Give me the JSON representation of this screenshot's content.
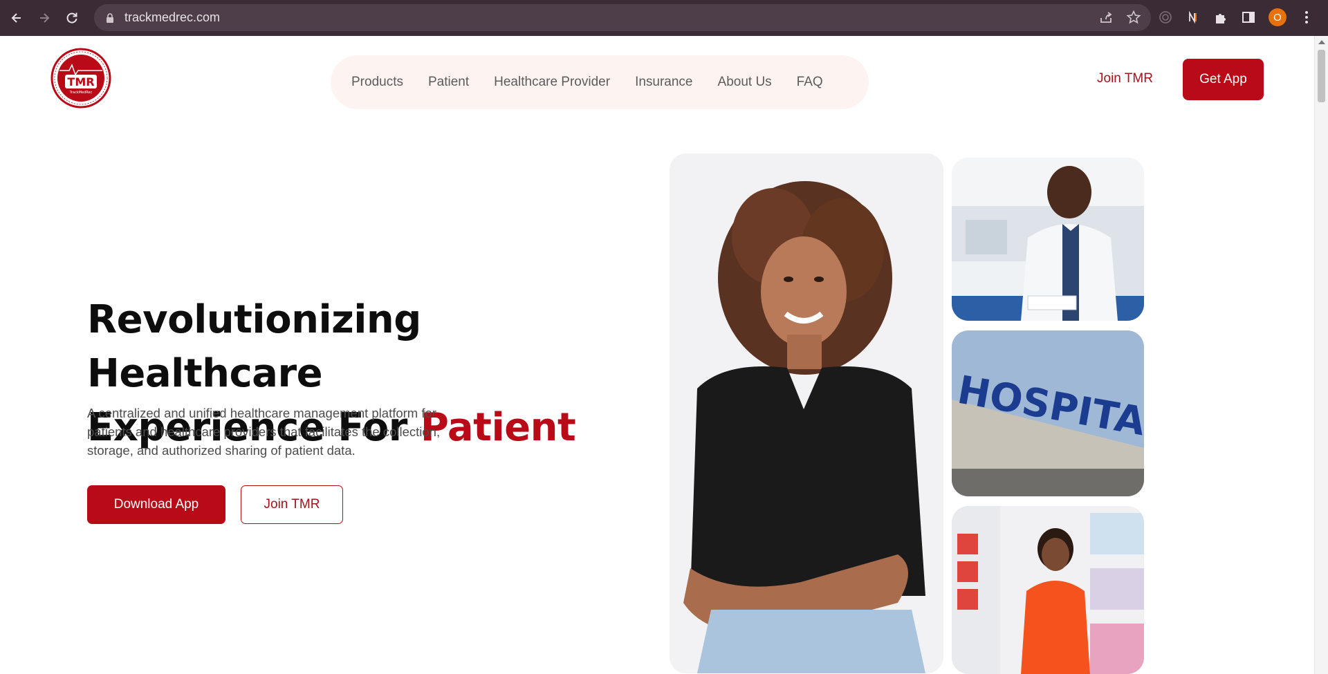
{
  "browser": {
    "url": "trackmedrec.com",
    "profile_initial": "O",
    "icons": [
      "back-arrow-icon",
      "forward-arrow-icon",
      "reload-icon",
      "lock-icon",
      "share-icon",
      "star-icon",
      "extension-icon",
      "notion-icon",
      "puzzle-icon",
      "sidepanel-icon",
      "menu-dots-icon"
    ]
  },
  "brand": {
    "logo_text": "TMR",
    "logo_subtext": "TrackMedRec",
    "accent_color": "#b90b17"
  },
  "nav": {
    "items": [
      "Products",
      "Patient",
      "Healthcare Provider",
      "Insurance",
      "About Us",
      "FAQ"
    ],
    "join_label": "Join TMR",
    "get_app_label": "Get App"
  },
  "hero": {
    "title_line1": "Revolutionizing Healthcare",
    "title_line2": "Experience For ",
    "title_accent": "Patient",
    "description": "A centralized and unified healthcare management platform for patients and healthcare providers that facilitates the collection, storage, and authorized sharing of patient data.",
    "download_label": "Download App",
    "join_label": "Join TMR"
  },
  "images": {
    "hospital_sign": "HOSPITAL"
  }
}
